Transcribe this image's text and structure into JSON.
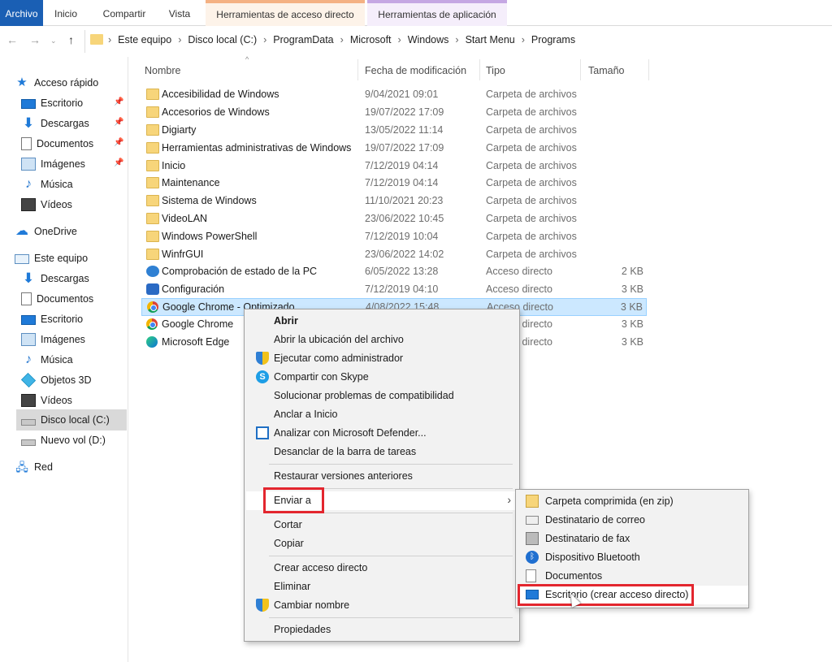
{
  "ribbon": {
    "tabs": [
      "Archivo",
      "Inicio",
      "Compartir",
      "Vista",
      "Herramientas de acceso directo",
      "Herramientas de aplicación"
    ]
  },
  "address": {
    "crumbs": [
      "Este equipo",
      "Disco local (C:)",
      "ProgramData",
      "Microsoft",
      "Windows",
      "Start Menu",
      "Programs"
    ]
  },
  "nav": {
    "quick_access": "Acceso rápido",
    "quick_items": [
      "Escritorio",
      "Descargas",
      "Documentos",
      "Imágenes",
      "Música",
      "Vídeos"
    ],
    "onedrive": "OneDrive",
    "this_pc": "Este equipo",
    "pc_items": [
      "Descargas",
      "Documentos",
      "Escritorio",
      "Imágenes",
      "Música",
      "Objetos 3D",
      "Vídeos",
      "Disco local (C:)",
      "Nuevo vol (D:)"
    ],
    "network": "Red"
  },
  "columns": {
    "name": "Nombre",
    "date": "Fecha de modificación",
    "type": "Tipo",
    "size": "Tamaño"
  },
  "files": [
    {
      "name": "Accesibilidad de Windows",
      "date": "9/04/2021 09:01",
      "type": "Carpeta de archivos",
      "size": ""
    },
    {
      "name": "Accesorios de Windows",
      "date": "19/07/2022 17:09",
      "type": "Carpeta de archivos",
      "size": ""
    },
    {
      "name": "Digiarty",
      "date": "13/05/2022 11:14",
      "type": "Carpeta de archivos",
      "size": ""
    },
    {
      "name": "Herramientas administrativas de Windows",
      "date": "19/07/2022 17:09",
      "type": "Carpeta de archivos",
      "size": ""
    },
    {
      "name": "Inicio",
      "date": "7/12/2019 04:14",
      "type": "Carpeta de archivos",
      "size": ""
    },
    {
      "name": "Maintenance",
      "date": "7/12/2019 04:14",
      "type": "Carpeta de archivos",
      "size": ""
    },
    {
      "name": "Sistema de Windows",
      "date": "11/10/2021 20:23",
      "type": "Carpeta de archivos",
      "size": ""
    },
    {
      "name": "VideoLAN",
      "date": "23/06/2022 10:45",
      "type": "Carpeta de archivos",
      "size": ""
    },
    {
      "name": "Windows PowerShell",
      "date": "7/12/2019 10:04",
      "type": "Carpeta de archivos",
      "size": ""
    },
    {
      "name": "WinfrGUI",
      "date": "23/06/2022 14:02",
      "type": "Carpeta de archivos",
      "size": ""
    },
    {
      "name": "Comprobación de estado de la PC",
      "date": "6/05/2022 13:28",
      "type": "Acceso directo",
      "size": "2 KB"
    },
    {
      "name": "Configuración",
      "date": "7/12/2019 04:10",
      "type": "Acceso directo",
      "size": "3 KB"
    },
    {
      "name": "Google Chrome - Optimizado",
      "date": "4/08/2022 15:48",
      "type": "Acceso directo",
      "size": "3 KB"
    },
    {
      "name": "Google Chrome",
      "date": "",
      "type": "Acceso directo",
      "size": "3 KB"
    },
    {
      "name": "Microsoft Edge",
      "date": "",
      "type": "Acceso directo",
      "size": "3 KB"
    }
  ],
  "context_menu": {
    "items": [
      "Abrir",
      "Abrir la ubicación del archivo",
      "Ejecutar como administrador",
      "Compartir con Skype",
      "Solucionar problemas de compatibilidad",
      "Anclar a Inicio",
      "Analizar con Microsoft Defender...",
      "Desanclar de la barra de tareas",
      "Restaurar versiones anteriores",
      "Enviar a",
      "Cortar",
      "Copiar",
      "Crear acceso directo",
      "Eliminar",
      "Cambiar nombre",
      "Propiedades"
    ]
  },
  "send_to": {
    "items": [
      "Carpeta comprimida (en zip)",
      "Destinatario de correo",
      "Destinatario de fax",
      "Dispositivo Bluetooth",
      "Documentos",
      "Escritorio (crear acceso directo)"
    ]
  },
  "colors": {
    "accent": "#1a5fb4",
    "highlight_box": "#e3262e",
    "selection": "#cce8ff"
  }
}
